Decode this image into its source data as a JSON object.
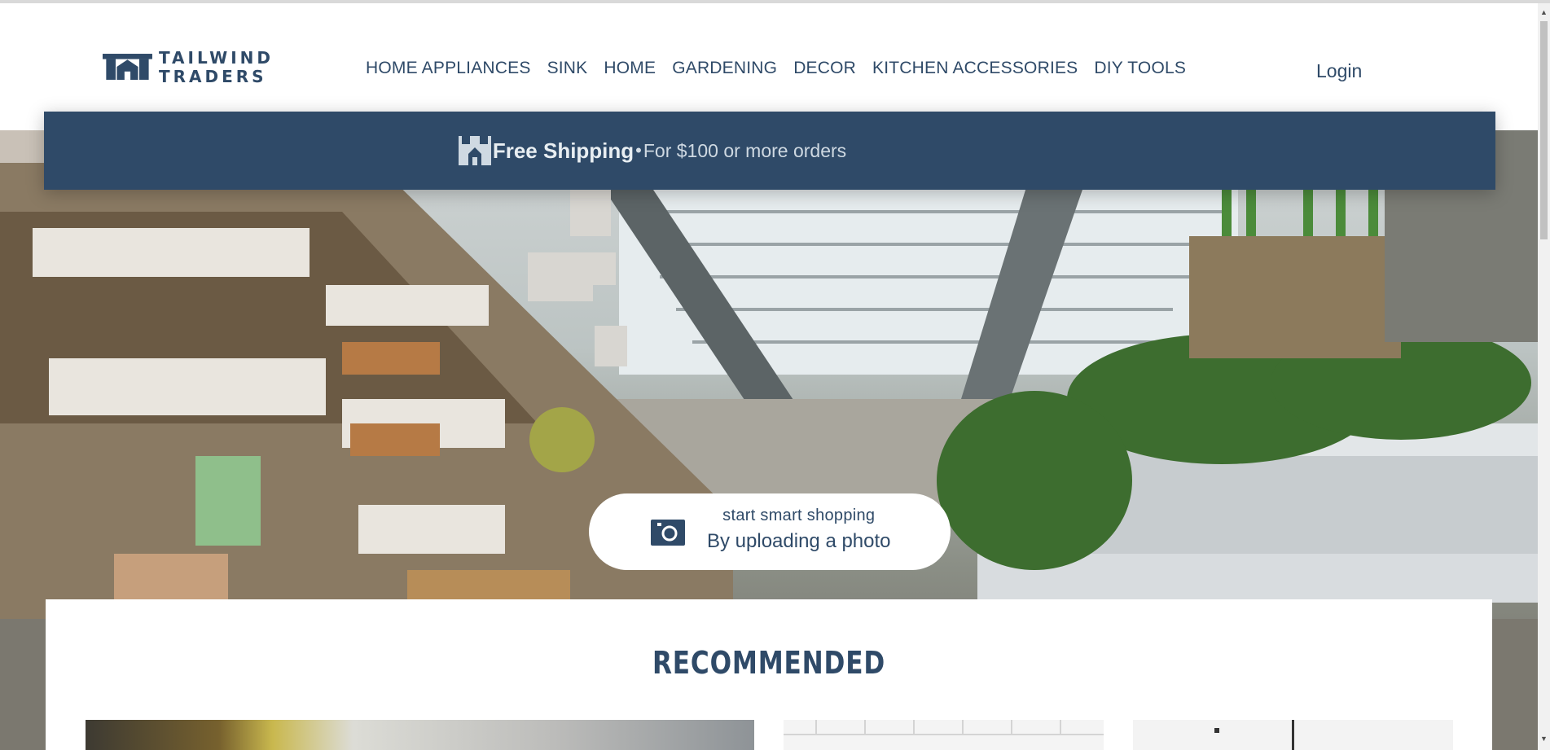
{
  "brand": {
    "line1": "TAILWIND",
    "line2": "TRADERS"
  },
  "nav": {
    "items": [
      {
        "label": "HOME APPLIANCES"
      },
      {
        "label": "SINK"
      },
      {
        "label": "HOME"
      },
      {
        "label": "GARDENING"
      },
      {
        "label": "DECOR"
      },
      {
        "label": "KITCHEN ACCESSORIES"
      },
      {
        "label": "DIY TOOLS"
      }
    ]
  },
  "login": {
    "label": "Login"
  },
  "shipping": {
    "title": "Free Shipping",
    "separator": "•",
    "description": "For $100 or more orders"
  },
  "upload": {
    "subtitle": "start smart shopping",
    "title": "By uploading a photo",
    "icon": "camera-icon"
  },
  "recommended": {
    "title": "RECOMMENDED"
  },
  "colors": {
    "primary": "#2f4a68",
    "background": "#ffffff"
  }
}
